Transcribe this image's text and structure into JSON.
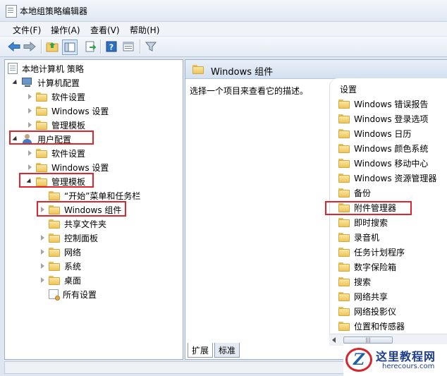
{
  "window": {
    "title": "本地组策略编辑器"
  },
  "menu": [
    "文件(F)",
    "操作(A)",
    "查看(V)",
    "帮助(H)"
  ],
  "toolbar": {
    "icons": [
      "back-arrow-icon",
      "forward-arrow-icon",
      "up-folder-icon",
      "show-hide-tree-icon",
      "export-list-icon",
      "help-icon",
      "properties-icon",
      "filter-icon"
    ]
  },
  "tree": {
    "root": "本地计算机 策略",
    "computer_config": "计算机配置",
    "software_settings_1": "软件设置",
    "windows_settings_1": "Windows 设置",
    "admin_templates_1": "管理模板",
    "user_config": "用户配置",
    "software_settings_2": "软件设置",
    "windows_settings_2": "Windows 设置",
    "admin_templates_2": "管理模板",
    "start_menu": "“开始”菜单和任务栏",
    "windows_components": "Windows 组件",
    "shared_folders": "共享文件夹",
    "control_panel": "控制面板",
    "network": "网络",
    "system": "系统",
    "desktop": "桌面",
    "all_settings": "所有设置"
  },
  "right_pane": {
    "header_title": "Windows 组件",
    "description": "选择一个项目来查看它的描述。",
    "column_header": "设置",
    "items": [
      "Windows 错误报告",
      "Windows 登录选项",
      "Windows 日历",
      "Windows 颜色系统",
      "Windows 移动中心",
      "Windows 资源管理器",
      "备份",
      "附件管理器",
      "即时搜索",
      "录音机",
      "任务计划程序",
      "数字保险箱",
      "搜索",
      "网络共享",
      "网络投影仪",
      "位置和传感器"
    ]
  },
  "tabs": [
    "扩展",
    "标准"
  ],
  "watermark": {
    "cn": "这里教程网",
    "en": "herecours.com",
    "logo_letter": "Z"
  }
}
